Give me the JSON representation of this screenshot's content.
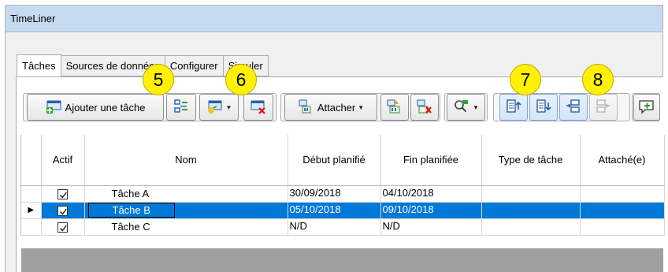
{
  "window": {
    "title": "TimeLiner"
  },
  "tabs": [
    {
      "label": "Tâches",
      "active": true
    },
    {
      "label": "Sources de données",
      "active": false
    },
    {
      "label": "Configurer",
      "active": false
    },
    {
      "label": "Simuler",
      "active": false
    }
  ],
  "toolbar": {
    "add_task_label": "Ajouter une tâche",
    "attach_label": "Attacher",
    "icons": {
      "auto_add": "auto-add-tasks-icon",
      "insert": "insert-task-icon",
      "delete": "delete-task-icon",
      "attach": "attach-icon",
      "auto_attach": "auto-attach-rules-icon",
      "clear_attach": "clear-attachments-icon",
      "find": "find-items-icon",
      "move_up": "move-up-icon",
      "move_down": "move-down-icon",
      "indent": "indent-icon",
      "outdent": "outdent-icon",
      "comment": "add-comment-icon"
    }
  },
  "callouts": [
    "5",
    "6",
    "7",
    "8"
  ],
  "grid": {
    "columns": [
      "Actif",
      "Nom",
      "Début planifié",
      "Fin planifiée",
      "Type de tâche",
      "Attaché(e)"
    ],
    "rows": [
      {
        "active": true,
        "name": "Tâche A",
        "start": "30/09/2018",
        "end": "04/10/2018",
        "type": "",
        "attached": "",
        "selected": false
      },
      {
        "active": true,
        "name": "Tâche B",
        "start": "05/10/2018",
        "end": "09/10/2018",
        "type": "",
        "attached": "",
        "selected": true
      },
      {
        "active": true,
        "name": "Tâche C",
        "start": "N/D",
        "end": "N/D",
        "type": "",
        "attached": "",
        "selected": false
      }
    ]
  },
  "colors": {
    "titlebar": "#c6daf0",
    "selection": "#0078d7",
    "callout": "#fff200"
  }
}
